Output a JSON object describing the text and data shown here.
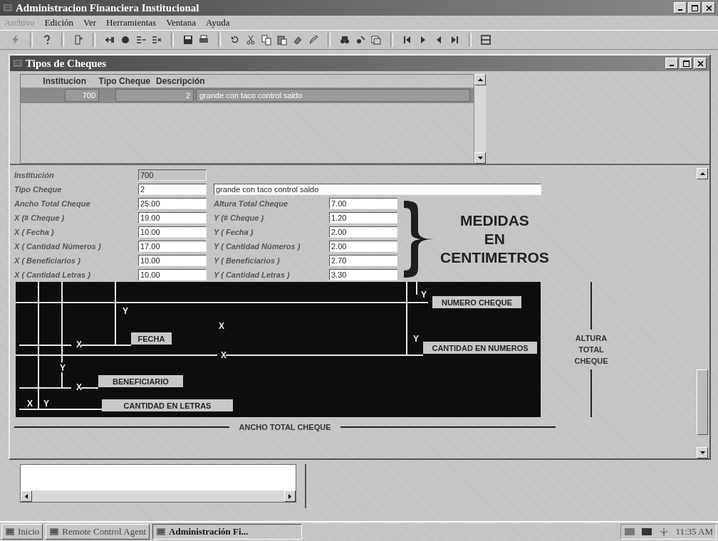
{
  "window": {
    "title": "Administracion Financiera Institucional"
  },
  "menu": [
    {
      "label": "Archivo",
      "disabled": true
    },
    {
      "label": "Edición",
      "disabled": false
    },
    {
      "label": "Ver",
      "disabled": false
    },
    {
      "label": "Herramientas",
      "disabled": false
    },
    {
      "label": "Ventana",
      "disabled": false
    },
    {
      "label": "Ayuda",
      "disabled": false
    }
  ],
  "child_window": {
    "title": "Tipos de Cheques"
  },
  "grid": {
    "columns": [
      "Institucion",
      "Tipo Cheque",
      "Descripción"
    ],
    "rows": [
      {
        "institucion": "700",
        "tipo_cheque": "2",
        "descripcion": "grande con taco control saldo",
        "selected": true
      }
    ]
  },
  "form": {
    "institucion": {
      "label": "Institución",
      "value": "700",
      "disabled": true
    },
    "tipo_cheque": {
      "label": "Tipo Cheque",
      "value": "2",
      "description": "grande con taco control saldo"
    },
    "measures": [
      {
        "x_label": "Ancho Total Cheque",
        "x_value": "25.00",
        "y_label": "Altura Total Cheque",
        "y_value": "7.00"
      },
      {
        "x_label": "X (# Cheque )",
        "x_value": "19.00",
        "y_label": "Y (# Cheque )",
        "y_value": "1.20"
      },
      {
        "x_label": "X ( Fecha )",
        "x_value": "10.00",
        "y_label": "Y ( Fecha )",
        "y_value": "2.00"
      },
      {
        "x_label": "X ( Cantidad Números )",
        "x_value": "17.00",
        "y_label": "Y ( Cantidad Números )",
        "y_value": "2.00"
      },
      {
        "x_label": "X ( Beneficiarios )",
        "x_value": "10.00",
        "y_label": "Y ( Beneficiarios )",
        "y_value": "2.70"
      },
      {
        "x_label": "X ( Cantidad Letras )",
        "x_value": "10.00",
        "y_label": "Y ( Cantidad Letras )",
        "y_value": "3.30"
      }
    ],
    "units_note": [
      "MEDIDAS",
      "EN",
      "CENTIMETROS"
    ]
  },
  "diagram": {
    "labels": [
      "NUMERO CHEQUE",
      "FECHA",
      "CANTIDAD EN NUMEROS",
      "BENEFICIARIO",
      "CANTIDAD EN LETRAS"
    ],
    "marks": [
      "Y",
      "Y",
      "X",
      "X",
      "Y",
      "X",
      "Y",
      "X",
      "X",
      "Y"
    ],
    "width_label": "ANCHO TOTAL CHEQUE",
    "height_label": "ALTURA TOTAL CHEQUE"
  },
  "taskbar": {
    "start": "Inicio",
    "tasks": [
      {
        "label": "Remote Control Agent",
        "selected": false
      },
      {
        "label": "Administración Fi...",
        "selected": true
      }
    ],
    "clock": "11:35 AM"
  }
}
